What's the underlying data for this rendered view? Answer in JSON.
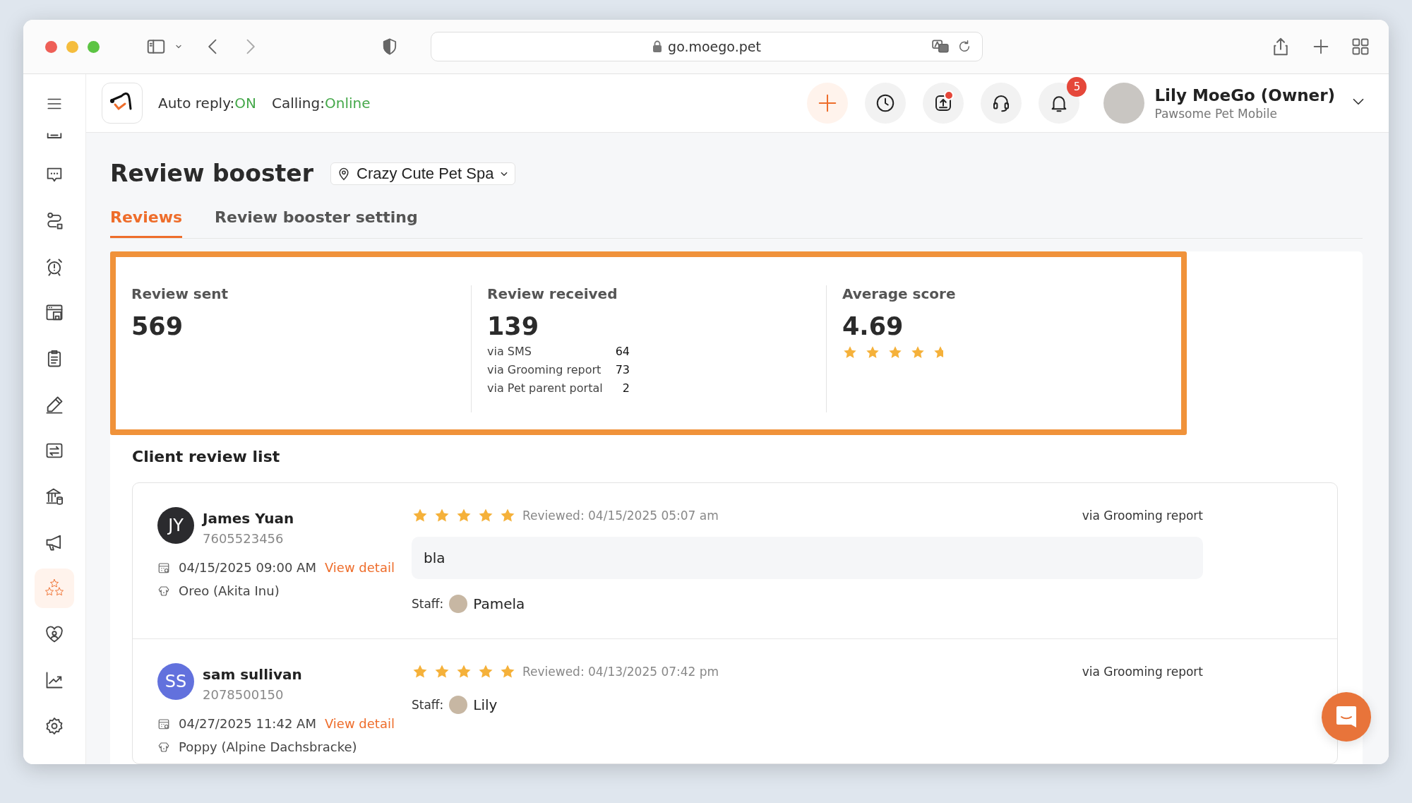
{
  "browser": {
    "url": "go.moego.pet"
  },
  "sidebar": {
    "items": [
      {
        "kind": "tray",
        "selected": false
      },
      {
        "kind": "chat",
        "selected": false
      },
      {
        "kind": "route",
        "selected": false
      },
      {
        "kind": "alarm",
        "selected": false
      },
      {
        "kind": "store",
        "selected": false
      },
      {
        "kind": "clipboard",
        "selected": false
      },
      {
        "kind": "pencil",
        "selected": false
      },
      {
        "kind": "transfer",
        "selected": false
      },
      {
        "kind": "bank",
        "selected": false
      },
      {
        "kind": "megaphone",
        "selected": false
      },
      {
        "kind": "stars",
        "selected": true
      },
      {
        "kind": "heart",
        "selected": false
      },
      {
        "kind": "chart",
        "selected": false
      },
      {
        "kind": "settings",
        "selected": false
      }
    ]
  },
  "header": {
    "auto_reply": {
      "label": "Auto reply:",
      "value": "ON"
    },
    "calling": {
      "label": "Calling:",
      "value": "Online"
    },
    "notifications": "5",
    "user": {
      "name": "Lily MoeGo (Owner)",
      "business": "Pawsome Pet Mobile"
    }
  },
  "page": {
    "title": "Review booster",
    "location": "Crazy Cute Pet Spa",
    "tabs": [
      {
        "label": "Reviews",
        "selected": true
      },
      {
        "label": "Review booster setting",
        "selected": false
      }
    ],
    "stats": {
      "sent": {
        "label": "Review sent",
        "value": "569"
      },
      "received": {
        "label": "Review received",
        "value": "139",
        "breakdown": [
          {
            "label": "via SMS",
            "value": "64"
          },
          {
            "label": "via Grooming report",
            "value": "73"
          },
          {
            "label": "via Pet parent portal",
            "value": "2"
          }
        ]
      },
      "average": {
        "label": "Average score",
        "value": "4.69",
        "stars": 4.69
      }
    },
    "list_title": "Client review list",
    "reviews": [
      {
        "initials": "JY",
        "color": "#2b2b2e",
        "name": "James Yuan",
        "phone": "7605523456",
        "appointment": "04/15/2025 09:00 AM",
        "link": "View detail",
        "pet": "Oreo (Akita Inu)",
        "stars": 5,
        "reviewed": "Reviewed: 04/15/2025 05:07 am",
        "source": "via Grooming report",
        "comment": "bla",
        "staff_label": "Staff:",
        "staff_name": "Pamela"
      },
      {
        "initials": "SS",
        "color": "#6271dd",
        "name": "sam sullivan",
        "phone": "2078500150",
        "appointment": "04/27/2025 11:42 AM",
        "link": "View detail",
        "pet": "Poppy (Alpine Dachsbracke)",
        "stars": 5,
        "reviewed": "Reviewed: 04/13/2025 07:42 pm",
        "source": "via Grooming report",
        "staff_label": "Staff:",
        "staff_name": "Lily"
      }
    ]
  }
}
